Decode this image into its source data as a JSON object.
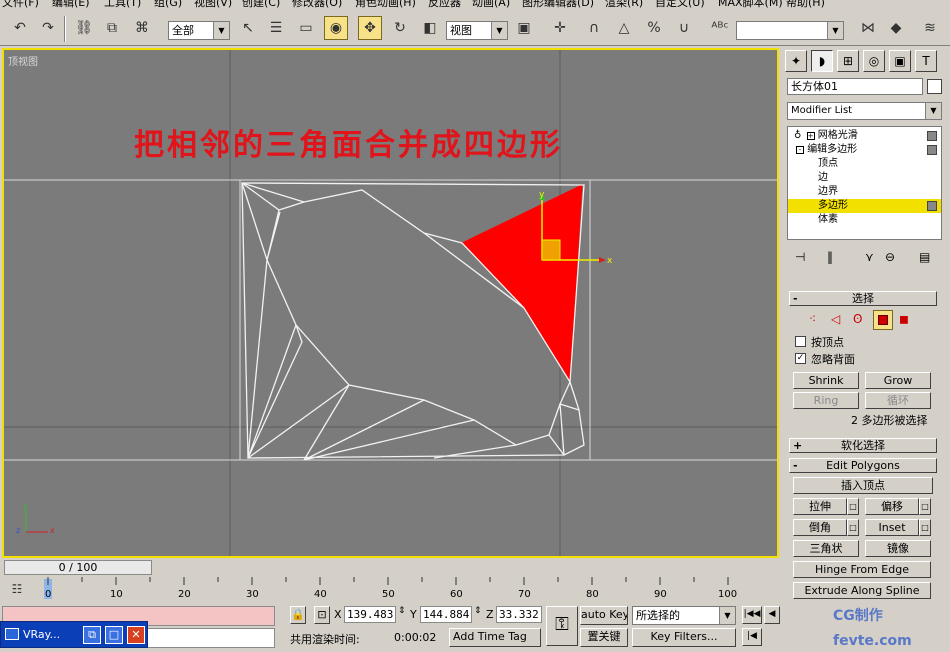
{
  "menu": [
    "文件(F)",
    "编辑(E)",
    "工具(T)",
    "组(G)",
    "视图(V)",
    "创建(C)",
    "修改器(O)",
    "角色动画(H)",
    "反应器",
    "动画(A)",
    "图形编辑器(D)",
    "渲染(R)",
    "自定义(U)",
    "MAX脚本(M)",
    "帮助(H)"
  ],
  "toolbar": {
    "selection_filter": "全部",
    "reference_coord": "视图",
    "named_selection": ""
  },
  "viewport": {
    "label": "顶视图",
    "caption": "把相邻的三角面合并成四边形",
    "axis_x": "x",
    "axis_y": "y",
    "axis_z": "z"
  },
  "timeline": {
    "slider": "0 / 100",
    "ticks": [
      "0",
      "10",
      "20",
      "30",
      "40",
      "50",
      "60",
      "70",
      "80",
      "90",
      "100"
    ]
  },
  "status": {
    "x_label": "X",
    "x_value": "139.483",
    "y_label": "Y",
    "y_value": "144.884",
    "z_label": "Z",
    "z_value": "33.332",
    "render_time_label": "共用渲染时间:",
    "render_time_value": "0:00:02",
    "add_time_tag": "Add Time Tag",
    "auto_key": "auto Key",
    "selected_mode": "所选择的",
    "set_key": "置关键",
    "key_filters": "Key Filters..."
  },
  "taskbar": {
    "item_label": "VRay..."
  },
  "panel": {
    "object_name": "长方体01",
    "modifier_list": "Modifier List",
    "stack": [
      {
        "label": "网格光滑",
        "indent": 0,
        "prefix": "+"
      },
      {
        "label": "编辑多边形",
        "indent": 0,
        "prefix": "-"
      },
      {
        "label": "顶点",
        "indent": 1,
        "prefix": ""
      },
      {
        "label": "边",
        "indent": 1,
        "prefix": ""
      },
      {
        "label": "边界",
        "indent": 1,
        "prefix": ""
      },
      {
        "label": "多边形",
        "indent": 1,
        "prefix": "",
        "selected": true
      },
      {
        "label": "体素",
        "indent": 1,
        "prefix": ""
      }
    ],
    "selection_title": "选择",
    "by_vertex": "按顶点",
    "ignore_backfacing": "忽略背面",
    "shrink": "Shrink",
    "grow": "Grow",
    "ring": "Ring",
    "loop": "循环",
    "selected_count": "2 多边形被选择",
    "soft_selection": "软化选择",
    "edit_polygons": "Edit Polygons",
    "insert_vertex": "插入顶点",
    "extrude": "拉伸",
    "outline": "偏移",
    "bevel": "倒角",
    "inset": "Inset",
    "triangulate": "三角状",
    "mirror": "镜像",
    "hinge": "Hinge From Edge",
    "extrude_along": "Extrude Along Spline"
  },
  "watermark": "CG制作 fevte.com"
}
